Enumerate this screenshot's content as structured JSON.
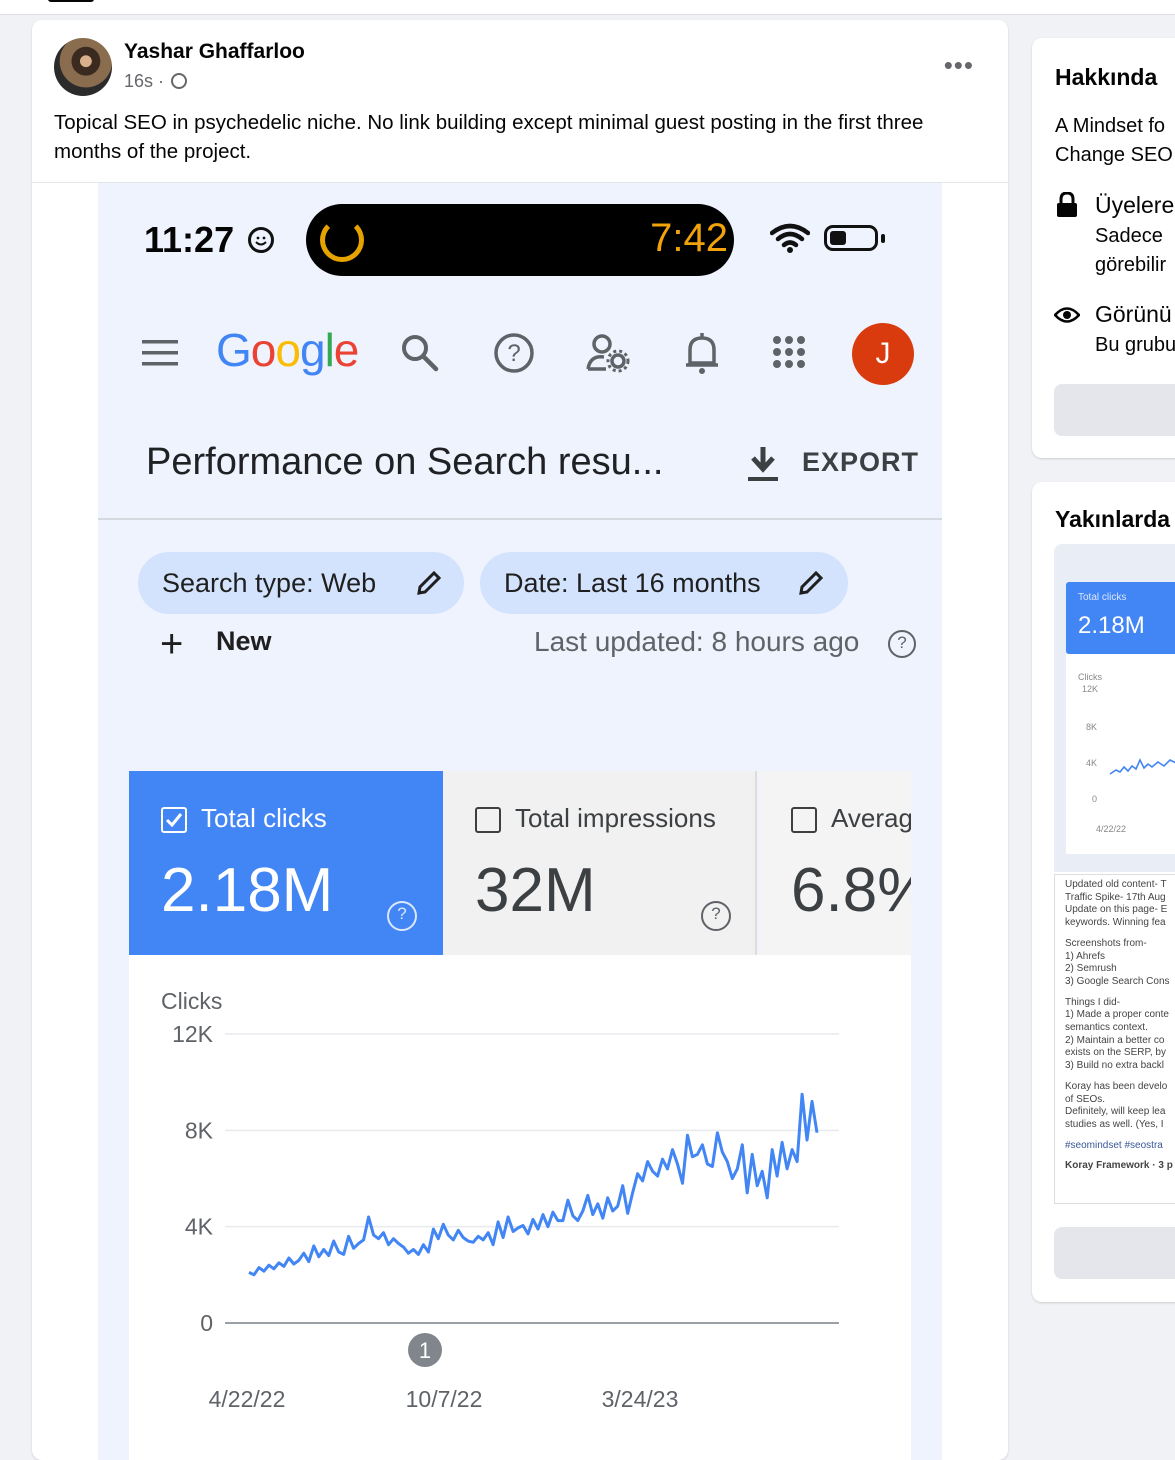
{
  "post": {
    "author": "Yashar Ghaffarloo",
    "timestamp": "16s",
    "separator": "·",
    "more_icon": "•••",
    "text": "Topical SEO in psychedelic niche. No link building except minimal guest posting in the first three months of the project."
  },
  "screenshot": {
    "status_time": "11:27",
    "timer": "7:42",
    "logo": {
      "letters": [
        "G",
        "o",
        "o",
        "g",
        "l",
        "e"
      ],
      "colors": [
        "#4285f4",
        "#ea4335",
        "#fbbc05",
        "#4285f4",
        "#34a853",
        "#ea4335"
      ]
    },
    "avatar_letter": "J",
    "page_title": "Performance on Search resu...",
    "export_label": "EXPORT",
    "chips": {
      "search_type": "Search type: Web",
      "date": "Date: Last 16 months"
    },
    "new_label": "New",
    "new_plus": "+",
    "last_updated": "Last updated: 8 hours ago",
    "help_glyph": "?",
    "metrics": [
      {
        "label": "Total clicks",
        "value": "2.18M",
        "selected": true
      },
      {
        "label": "Total impressions",
        "value": "32M",
        "selected": false
      },
      {
        "label": "Averag",
        "value": "6.8%",
        "selected": false
      }
    ],
    "accent_color": "#4285f4"
  },
  "chart_data": {
    "type": "line",
    "ylabel": "Clicks",
    "yticks": [
      "12K",
      "8K",
      "4K",
      "0"
    ],
    "xticks": [
      "4/22/22",
      "10/7/22",
      "3/24/23"
    ],
    "ylim": [
      0,
      12000
    ],
    "annotation": "1",
    "series": [
      {
        "color": "#4285f4",
        "values": [
          2100,
          2000,
          2300,
          2150,
          2400,
          2250,
          2500,
          2350,
          2700,
          2450,
          2600,
          2900,
          2550,
          3200,
          2750,
          3050,
          2800,
          3400,
          2950,
          2850,
          3600,
          3100,
          3300,
          3450,
          4400,
          3650,
          3500,
          3750,
          3250,
          3500,
          3300,
          3150,
          2900,
          3050,
          2850,
          3250,
          2950,
          3900,
          3500,
          4100,
          3650,
          3450,
          3850,
          3550,
          3400,
          3350,
          3600,
          3450,
          3750,
          3250,
          4200,
          3550,
          4400,
          3800,
          3950,
          4050,
          3700,
          4300,
          3900,
          4500,
          4000,
          4600,
          4250,
          4250,
          5100,
          4450,
          4250,
          4650,
          5300,
          4500,
          4950,
          4350,
          5200,
          4650,
          4850,
          5700,
          4550,
          5400,
          6200,
          5900,
          6700,
          6300,
          6100,
          6800,
          6400,
          7200,
          6600,
          5800,
          7800,
          6900,
          7000,
          7400,
          6600,
          6500,
          7900,
          7100,
          6700,
          6000,
          6400,
          7400,
          5400,
          7000,
          5700,
          6300,
          5200,
          7200,
          6100,
          7500,
          6400,
          7200,
          6700,
          9500,
          7600,
          9200,
          7900
        ]
      }
    ]
  },
  "sidebar": {
    "about": {
      "heading": "Hakkında",
      "description_lines": [
        "A Mindset fo",
        "Change SEO"
      ],
      "private_title": "Üyelere",
      "private_lines": [
        "Sadece",
        "görebilir"
      ],
      "visible_title": "Görünü",
      "visible_line": "Bu grubu"
    },
    "recent": {
      "heading": "Yakınlarda",
      "thumb_label": "Total clicks",
      "thumb_value": "2.18M",
      "thumb_ylabel": "Clicks",
      "thumb_yticks": [
        "12K",
        "8K",
        "4K",
        "0"
      ],
      "thumb_xtick": "4/22/22",
      "text_lines": [
        "Updated old content- T",
        "Traffic Spike- 17th Aug",
        "Update on this page- E",
        "keywords. Winning fea",
        "",
        "Screenshots from-",
        "1) Ahrefs",
        "2) Semrush",
        "3) Google Search Cons",
        "",
        "Things I did-",
        "1) Made a proper conte",
        "semantics context.",
        "2) Maintain a better co",
        "exists on the SERP, by",
        "3) Build no extra backl",
        "",
        "Koray has been develo",
        "of SEOs.",
        "Definitely, will keep lea",
        "studies as well. (Yes, I",
        "",
        "#seomindset #seostra",
        "",
        "Koray Framework · 3 p"
      ]
    }
  }
}
